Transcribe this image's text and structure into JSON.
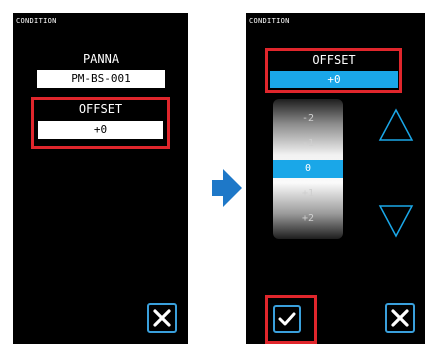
{
  "left_screen": {
    "title": "CONDITION",
    "panna_label": "PANNA",
    "panna_value": "PM-BS-001",
    "offset_label": "OFFSET",
    "offset_value": "+0"
  },
  "right_screen": {
    "title": "CONDITION",
    "offset_label": "OFFSET",
    "offset_value": "+0",
    "drum_values": [
      "-2",
      "-1",
      "0",
      "+1",
      "+2"
    ],
    "selected_value": "0"
  },
  "colors": {
    "accent_blue": "#1aa7e8",
    "highlight_red": "#e0262c",
    "button_border": "#3aa0dc",
    "arrow_blue": "#1e78c8"
  },
  "icons": {
    "close": "close-icon",
    "confirm": "check-icon",
    "up": "triangle-up-icon",
    "down": "triangle-down-icon",
    "next": "arrow-right-icon"
  }
}
